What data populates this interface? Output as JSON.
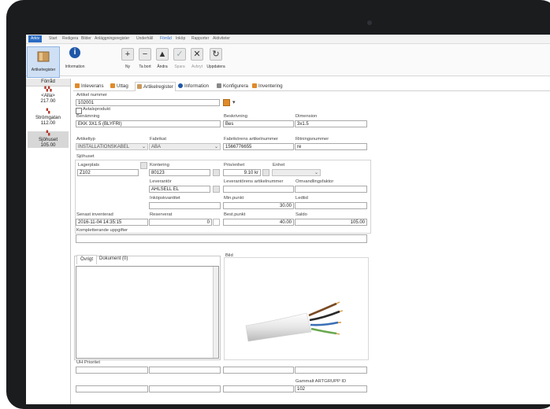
{
  "menu": {
    "items": [
      "Arkiv",
      "Start",
      "Redigera",
      "Bilder",
      "Anläggningsregister",
      "Underhåll",
      "Förråd",
      "Inköp",
      "Rapporter",
      "Aktiviteter"
    ],
    "active": "Arkiv",
    "selected": "Förråd"
  },
  "ribbon": {
    "artikelregister": "Artikelregister",
    "information": "Information",
    "ny": "Ny",
    "ta_bort": "Ta bort",
    "andra": "Ändra",
    "spara": "Spara",
    "avbryt": "Avbryt",
    "uppdatera": "Uppdatera"
  },
  "sidebar": {
    "header": "Förråd",
    "items": [
      {
        "name": "<Alla>",
        "value": "217.00"
      },
      {
        "name": "Strömgatan",
        "value": "112.00"
      },
      {
        "name": "Sjöhuset",
        "value": "105.00"
      }
    ]
  },
  "tabs": [
    "Inleverans",
    "Uttag",
    "Artikelregister",
    "Information",
    "Konfigurera",
    "Inventering"
  ],
  "colors": {
    "accent": "#2b6cc4",
    "tab_icon": "#e08a2a"
  },
  "form": {
    "artikelnummer_label": "Artikel nummer",
    "artikelnummer": "102001",
    "avtalsprodukt": "Avtalsprodukt",
    "benamning_label": "Benämning",
    "benamning": "EKK 3X1.5  (BLYFRI)",
    "beskrivning_label": "Beskrivning",
    "beskrivning": "Bes",
    "dimension_label": "Dimension",
    "dimension": "3x1.5",
    "artikeltyp_label": "Artikeltyp",
    "artikeltyp": "INSTALLATIONSKABEL",
    "fabrikat_label": "Fabrikat",
    "fabrikat": "ABA",
    "fabrikorens_label": "Fabrikörens artikelnummer",
    "fabrikorens": "1566776655",
    "ritningsnummer_label": "Ritningsnummer",
    "ritningsnummer": "re",
    "group_label": "Sjöhuset",
    "lagerplats_label": "Lagerplats",
    "lagerplats": "Z102",
    "kontering_label": "Kontering",
    "kontering": "80123",
    "pris_label": "Pris/enhet",
    "pris": "9.10 kr",
    "enhet_label": "Enhet",
    "leverantor_label": "Leverantör",
    "leverantor": "AHLSELL EL",
    "lev_artnr_label": "Leverantörens artikelnummer",
    "omvandling_label": "Omvandlingsfaktor",
    "inkopskvantitet_label": "Inköpskvantitet",
    "minpunkt_label": "Min.punkt",
    "minpunkt": "30.00",
    "ledtid_label": "Ledtid",
    "senast_label": "Senast inventerad",
    "senast": "2016-11-04 14:35:15",
    "reserverat_label": "Reserverat",
    "reserverat": "0",
    "bestpunkt_label": "Best.punkt",
    "bestpunkt": "40.00",
    "saldo_label": "Saldo",
    "saldo": "105.00",
    "komplett_label": "Kompletterande uppgifter",
    "ovrigt_tab": "Övrigt",
    "dokument_tab": "Dokument (0)",
    "bild_label": "Bild",
    "uh_label": "UH Prioritet",
    "gammalt_label": "Gammalt ARTGRUPP ID",
    "gammalt": "102"
  }
}
